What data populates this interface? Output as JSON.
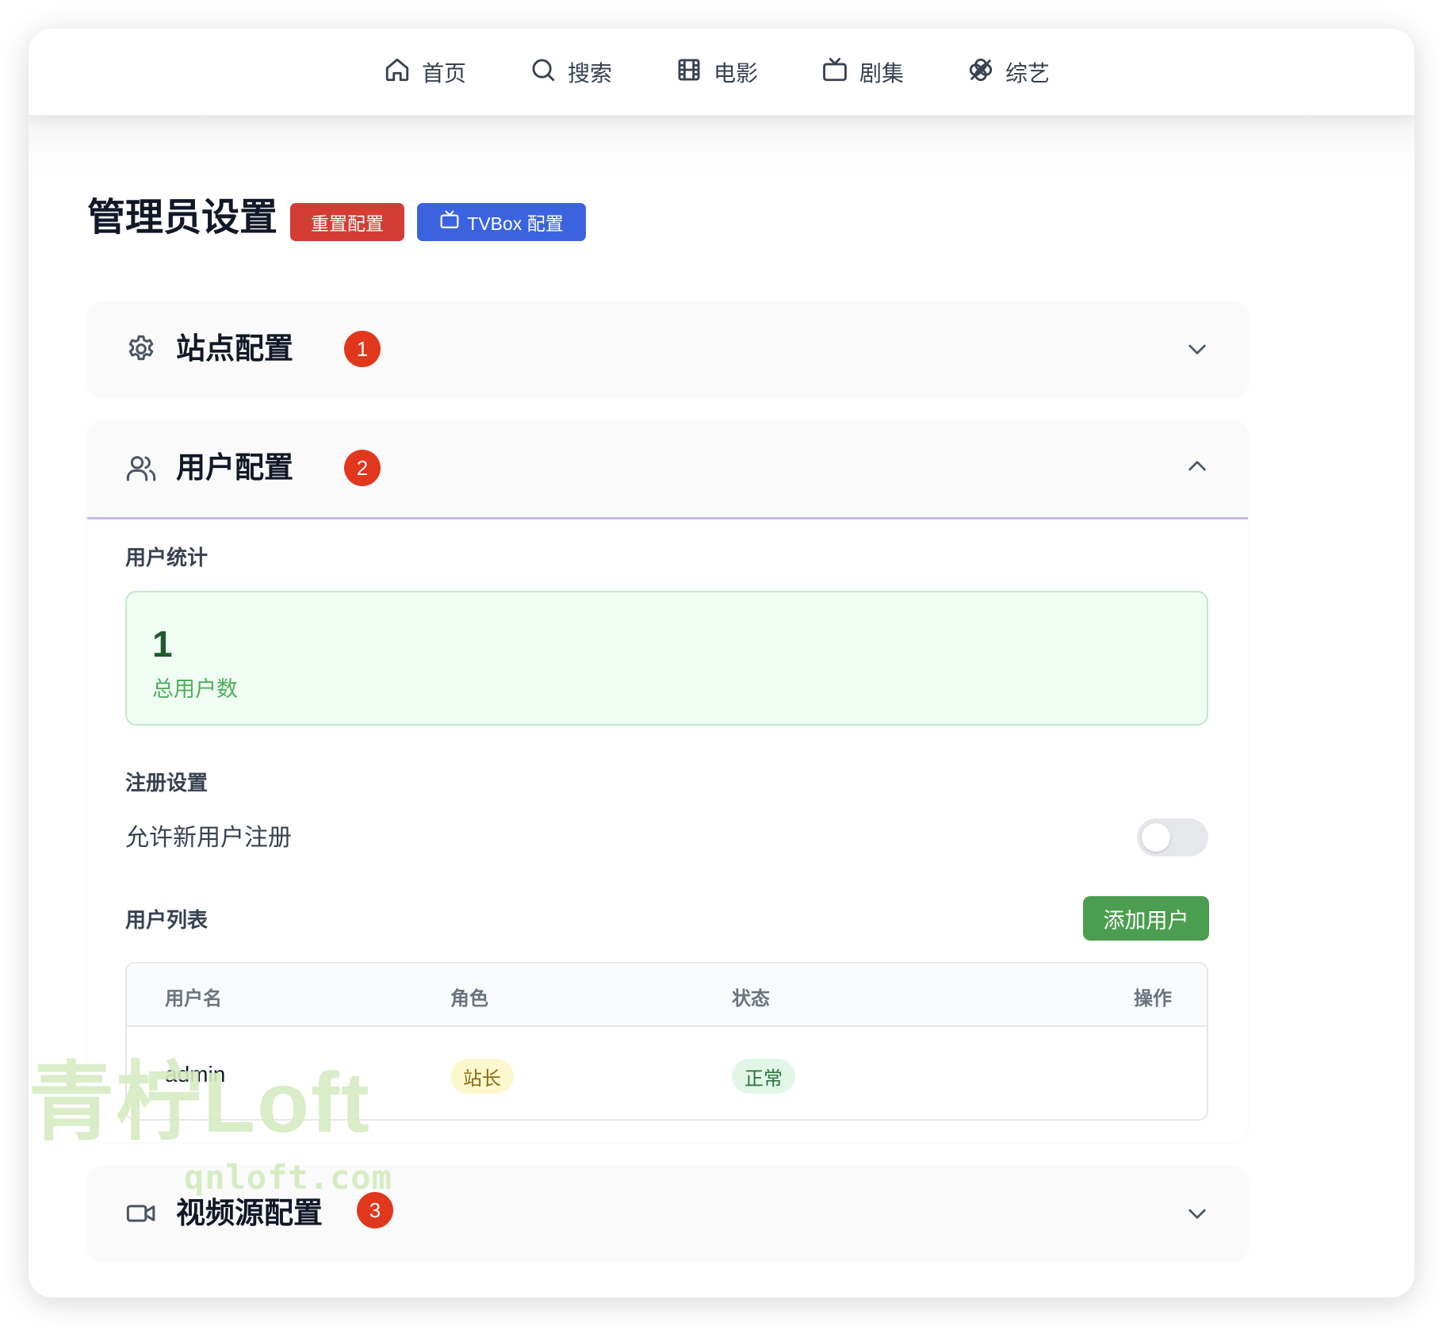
{
  "nav": {
    "items": [
      {
        "label": "首页",
        "icon": "home-icon"
      },
      {
        "label": "搜索",
        "icon": "search-icon"
      },
      {
        "label": "电影",
        "icon": "film-icon"
      },
      {
        "label": "剧集",
        "icon": "tv-icon"
      },
      {
        "label": "综艺",
        "icon": "clover-icon"
      }
    ]
  },
  "page": {
    "title": "管理员设置",
    "reset_button": "重置配置",
    "tvbox_button": "TVBox 配置"
  },
  "sections": {
    "site": {
      "title": "站点配置",
      "badge": "1",
      "expanded": false
    },
    "user": {
      "title": "用户配置",
      "badge": "2",
      "expanded": true
    },
    "video": {
      "title": "视频源配置",
      "badge": "3",
      "expanded": false
    }
  },
  "user_config": {
    "stats_heading": "用户统计",
    "total_users_value": "1",
    "total_users_label": "总用户数",
    "registration_heading": "注册设置",
    "allow_registration_label": "允许新用户注册",
    "allow_registration": false,
    "list_heading": "用户列表",
    "add_user_button": "添加用户",
    "table": {
      "columns": [
        "用户名",
        "角色",
        "状态",
        "操作"
      ],
      "rows": [
        {
          "username": "admin",
          "role": "站长",
          "status": "正常"
        }
      ]
    }
  },
  "watermark": {
    "main": "青柠Loft",
    "sub": "qnloft.com"
  },
  "colors": {
    "reset_button": "#d43c34",
    "tvbox_button": "#3b63e0",
    "badge": "#e0371d",
    "add_button": "#4b9e4f",
    "stat_card_bg": "#f0fdf2"
  }
}
